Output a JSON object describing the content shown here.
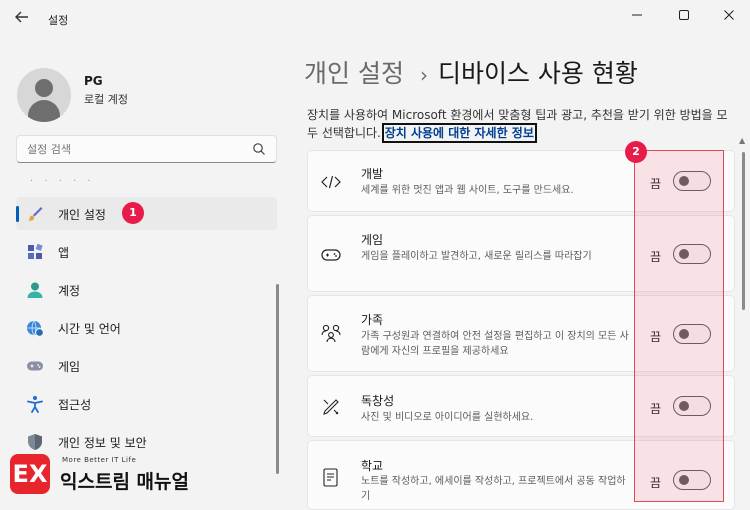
{
  "window": {
    "title": "설정",
    "back_icon": "back-arrow-icon",
    "controls": [
      "minimize-icon",
      "maximize-icon",
      "close-icon"
    ]
  },
  "user": {
    "name": "PG",
    "account_type": "로컬 계정"
  },
  "search": {
    "placeholder": "설정 검색"
  },
  "sidebar": {
    "items": [
      {
        "label": "개인 설정",
        "icon": "brush-icon",
        "selected": true
      },
      {
        "label": "앱",
        "icon": "apps-icon"
      },
      {
        "label": "계정",
        "icon": "account-icon"
      },
      {
        "label": "시간 및 언어",
        "icon": "globe-clock-icon"
      },
      {
        "label": "게임",
        "icon": "gamepad-icon"
      },
      {
        "label": "접근성",
        "icon": "accessibility-icon"
      },
      {
        "label": "개인 정보 및 보안",
        "icon": "shield-icon"
      }
    ]
  },
  "main": {
    "breadcrumb_parent": "개인 설정",
    "breadcrumb_separator": "›",
    "breadcrumb_current": "디바이스 사용 현황",
    "description": "장치를 사용하여 Microsoft 환경에서 맞춤형 팁과 광고, 추천을 받기 위한 방법을 모두 선택합니다. ",
    "description_link": "장치 사용에 대한 자세한 정보",
    "cards": [
      {
        "title": "개발",
        "description": "세계를 위한 멋진 앱과 웹 사이트, 도구를 만드세요.",
        "state": "끔",
        "icon": "code-icon",
        "on": false
      },
      {
        "title": "게임",
        "description": "게임을 플레이하고 발견하고, 새로운 릴리스를 따라잡기",
        "state": "끔",
        "icon": "gamepad-icon",
        "on": false
      },
      {
        "title": "가족",
        "description": "가족 구성원과 연결하여 안전 설정을 편집하고 이 장치의 모든 사람에게 자신의 프로필을 제공하세요",
        "state": "끔",
        "icon": "family-icon",
        "on": false
      },
      {
        "title": "독창성",
        "description": "사진 및 비디오로 아이디어를 실현하세요.",
        "state": "끔",
        "icon": "pen-brush-icon",
        "on": false
      },
      {
        "title": "학교",
        "description": "노트를 작성하고, 에세이를 작성하고, 프로젝트에서 공동 작업하기",
        "state": "끔",
        "icon": "school-icon",
        "on": false
      }
    ]
  },
  "annotations": {
    "badge_1": "1",
    "badge_2": "2",
    "highlight_color": "#e05a6a"
  },
  "watermark": {
    "tagline": "More Better IT Life",
    "name": "익스트림 매뉴얼",
    "logo_text": "EX"
  }
}
